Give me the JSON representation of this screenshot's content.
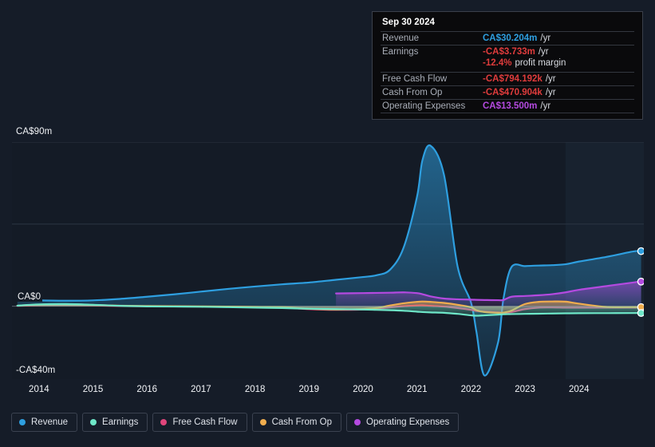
{
  "axis": {
    "y_top_label": "CA$90m",
    "y_zero_label": "CA$0",
    "y_bottom_label": "-CA$40m",
    "x_labels": [
      "2014",
      "2015",
      "2016",
      "2017",
      "2018",
      "2019",
      "2020",
      "2021",
      "2022",
      "2023",
      "2024"
    ]
  },
  "tooltip": {
    "date": "Sep 30 2024",
    "rows": [
      {
        "key": "Revenue",
        "value": "CA$30.204m",
        "unit": "/yr",
        "color": "#2e9fe0"
      },
      {
        "key": "Earnings",
        "value": "-CA$3.733m",
        "unit": "/yr",
        "color": "#e03c3c"
      },
      {
        "key": "",
        "value": "-12.4%",
        "unit": "profit margin",
        "color": "#e03c3c"
      },
      {
        "key": "Free Cash Flow",
        "value": "-CA$794.192k",
        "unit": "/yr",
        "color": "#e03c3c"
      },
      {
        "key": "Cash From Op",
        "value": "-CA$470.904k",
        "unit": "/yr",
        "color": "#e03c3c"
      },
      {
        "key": "Operating Expenses",
        "value": "CA$13.500m",
        "unit": "/yr",
        "color": "#b44ae0"
      }
    ]
  },
  "legend": [
    {
      "label": "Revenue",
      "color": "#2e9fe0"
    },
    {
      "label": "Earnings",
      "color": "#6ee7c8"
    },
    {
      "label": "Free Cash Flow",
      "color": "#e0457b"
    },
    {
      "label": "Cash From Op",
      "color": "#f0ad4e"
    },
    {
      "label": "Operating Expenses",
      "color": "#b44ae0"
    }
  ],
  "colors": {
    "plot_background": "#141b26",
    "page_background": "#151c28",
    "gridline": "#2b3442",
    "forecast_band": "#18222f"
  },
  "chart_data": {
    "type": "area",
    "title": "",
    "xlabel": "",
    "ylabel": "",
    "xlim": [
      2013.5,
      2025.2
    ],
    "ylim": [
      -40,
      90
    ],
    "ytick_values": [
      90,
      45,
      0,
      -40
    ],
    "ytick_labels": [
      "CA$90m",
      "",
      "CA$0",
      "-CA$40m"
    ],
    "gridlines": [
      90,
      45,
      0
    ],
    "grid": true,
    "legend_position": "bottom",
    "forecast_region_start": 2023.75,
    "x": [
      2013.6,
      2014.0,
      2014.5,
      2015.0,
      2015.5,
      2016.0,
      2016.5,
      2017.0,
      2017.5,
      2018.0,
      2018.5,
      2019.0,
      2019.5,
      2020.0,
      2020.25,
      2020.5,
      2020.75,
      2021.0,
      2021.1,
      2021.25,
      2021.5,
      2021.75,
      2022.0,
      2022.1,
      2022.25,
      2022.5,
      2022.6,
      2022.75,
      2023.0,
      2023.25,
      2023.5,
      2023.75,
      2024.0,
      2024.5,
      2025.0,
      2025.15
    ],
    "series": [
      {
        "name": "Revenue",
        "color": "#2e9fe0",
        "values": [
          3.5,
          3.2,
          3.0,
          3.2,
          4.0,
          5.2,
          6.5,
          8.0,
          9.5,
          10.8,
          12.0,
          13.0,
          14.5,
          16.0,
          17.0,
          20.0,
          32.0,
          60.0,
          80.0,
          88.0,
          72.0,
          22.0,
          2.0,
          -14.0,
          -38.0,
          -20.0,
          4.0,
          21.5,
          22.0,
          22.3,
          22.5,
          23.0,
          24.5,
          27.0,
          30.0,
          30.204
        ]
      },
      {
        "name": "Earnings",
        "color": "#6ee7c8",
        "values": [
          0.3,
          1.0,
          1.2,
          0.8,
          0.2,
          -0.1,
          -0.2,
          -0.3,
          -0.5,
          -0.8,
          -1.0,
          -1.4,
          -1.6,
          -1.8,
          -2.0,
          -2.2,
          -2.5,
          -3.0,
          -3.2,
          -3.4,
          -3.6,
          -4.2,
          -5.0,
          -5.2,
          -5.0,
          -4.6,
          -4.4,
          -4.3,
          -4.2,
          -4.1,
          -4.0,
          -3.9,
          -3.85,
          -3.8,
          -3.75,
          -3.733
        ]
      },
      {
        "name": "Free Cash Flow",
        "color": "#e0457b",
        "values": [
          0.2,
          0.5,
          0.6,
          0.4,
          0.1,
          0.0,
          -0.1,
          -0.2,
          -0.3,
          -0.5,
          -0.7,
          -1.6,
          -2.0,
          -1.8,
          -1.4,
          -0.6,
          0.0,
          0.4,
          0.5,
          0.2,
          -0.2,
          -1.0,
          -2.0,
          -2.6,
          -3.0,
          -3.4,
          -3.6,
          -3.2,
          -1.6,
          -0.8,
          -0.7,
          -0.8,
          -0.8,
          -0.8,
          -0.79,
          -0.794
        ]
      },
      {
        "name": "Cash From Op",
        "color": "#f0ad4e",
        "values": [
          0.3,
          0.9,
          1.1,
          0.7,
          0.3,
          0.1,
          0.0,
          -0.1,
          -0.2,
          -0.4,
          -0.5,
          -1.4,
          -1.8,
          -1.5,
          -1.0,
          0.4,
          1.6,
          2.4,
          2.6,
          2.4,
          1.8,
          0.8,
          -0.6,
          -2.2,
          -3.2,
          -3.6,
          -3.5,
          -2.4,
          1.2,
          2.4,
          2.6,
          2.5,
          1.4,
          -0.4,
          -0.5,
          -0.471
        ]
      },
      {
        "name": "Operating Expenses",
        "color": "#b44ae0",
        "values": [
          null,
          null,
          null,
          null,
          null,
          null,
          null,
          null,
          null,
          null,
          null,
          null,
          7.0,
          7.2,
          7.3,
          7.4,
          7.6,
          7.2,
          6.6,
          5.4,
          4.2,
          3.8,
          3.6,
          3.5,
          3.4,
          3.3,
          3.4,
          5.2,
          5.6,
          6.0,
          6.6,
          7.6,
          9.0,
          11.0,
          13.0,
          13.5
        ]
      }
    ]
  }
}
